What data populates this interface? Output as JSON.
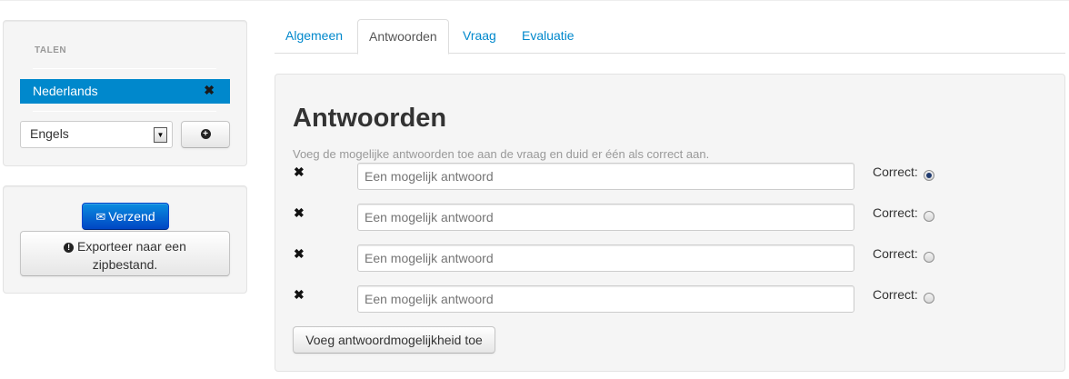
{
  "sidebar": {
    "languages_header": "TALEN",
    "active_language": "Nederlands",
    "remove_glyph": "✖",
    "language_select_value": "Engels",
    "add_language_icon": "plus-circle-icon",
    "send_label": "Verzend",
    "export_label_line1": "Exporteer naar een",
    "export_label_line2": "zipbestand."
  },
  "tabs": [
    {
      "label": "Algemeen",
      "active": false
    },
    {
      "label": "Antwoorden",
      "active": true
    },
    {
      "label": "Vraag",
      "active": false
    },
    {
      "label": "Evaluatie",
      "active": false
    }
  ],
  "main": {
    "title": "Antwoorden",
    "help_text": "Voeg de mogelijke antwoorden toe aan de vraag en duid er één als correct aan.",
    "answers": [
      {
        "placeholder": "Een mogelijk antwoord",
        "value": "",
        "correct_label": "Correct:",
        "correct": true
      },
      {
        "placeholder": "Een mogelijk antwoord",
        "value": "",
        "correct_label": "Correct:",
        "correct": false
      },
      {
        "placeholder": "Een mogelijk antwoord",
        "value": "",
        "correct_label": "Correct:",
        "correct": false
      },
      {
        "placeholder": "Een mogelijk antwoord",
        "value": "",
        "correct_label": "Correct:",
        "correct": false
      }
    ],
    "add_answer_label": "Voeg antwoordmogelijkheid toe"
  },
  "colors": {
    "accent": "#0088cc",
    "primary_button": "#0055cc",
    "panel_bg": "#f5f5f5"
  }
}
